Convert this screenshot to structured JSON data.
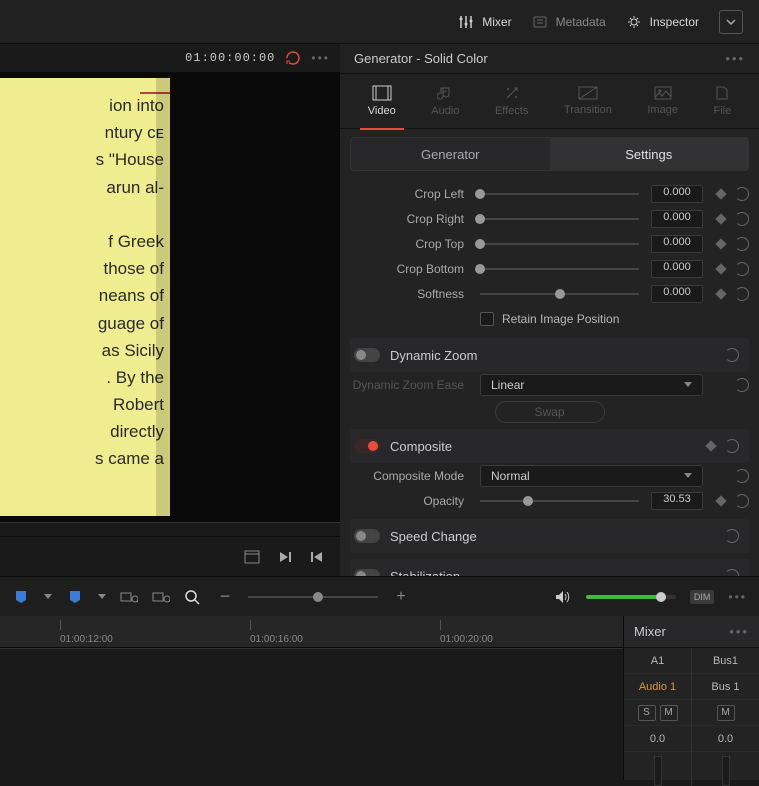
{
  "top_toolbar": {
    "mixer": "Mixer",
    "metadata": "Metadata",
    "inspector": "Inspector"
  },
  "viewer": {
    "timecode": "01:00:00:00",
    "page_text": "ion into\nntury ᴄᴇ\ns \"House\narun al-\n\nf Greek\nthose of\nneans of\nguage of\nas Sicily\n. By the\n Robert\n directly\ns came a"
  },
  "inspector": {
    "title": "Generator - Solid Color",
    "tabs": {
      "video": "Video",
      "audio": "Audio",
      "effects": "Effects",
      "transition": "Transition",
      "image": "Image",
      "file": "File"
    },
    "subtabs": {
      "generator": "Generator",
      "settings": "Settings"
    },
    "crop": {
      "left_label": "Crop Left",
      "left_value": "0.000",
      "right_label": "Crop Right",
      "right_value": "0.000",
      "top_label": "Crop Top",
      "top_value": "0.000",
      "bottom_label": "Crop Bottom",
      "bottom_value": "0.000",
      "softness_label": "Softness",
      "softness_value": "0.000",
      "retain_label": "Retain Image Position"
    },
    "dynamic_zoom": {
      "title": "Dynamic Zoom",
      "ease_label": "Dynamic Zoom Ease",
      "ease_value": "Linear",
      "swap": "Swap"
    },
    "composite": {
      "title": "Composite",
      "mode_label": "Composite Mode",
      "mode_value": "Normal",
      "opacity_label": "Opacity",
      "opacity_value": "30.53"
    },
    "speed_change": {
      "title": "Speed Change"
    },
    "stabilization": {
      "title": "Stabilization"
    }
  },
  "timeline": {
    "dim_label": "DIM",
    "ticks": [
      "01:00:12:00",
      "01:00:16:00",
      "01:00:20:00"
    ]
  },
  "mixer": {
    "title": "Mixer",
    "channels": [
      {
        "id": "A1",
        "name": "Audio 1",
        "level": "0.0",
        "highlight": true
      },
      {
        "id": "Bus1",
        "name": "Bus 1",
        "level": "0.0",
        "highlight": false
      }
    ]
  }
}
